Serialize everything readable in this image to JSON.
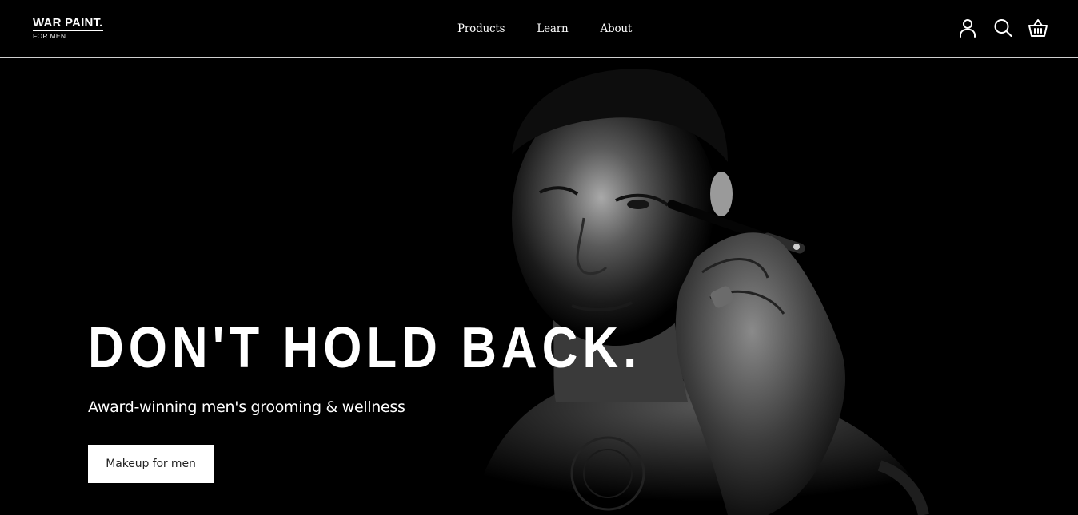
{
  "brand": {
    "name": "WAR PAINT.",
    "tagline": "FOR MEN"
  },
  "nav": {
    "items": [
      "Products",
      "Learn",
      "About"
    ]
  },
  "header_icons": [
    "account-icon",
    "search-icon",
    "basket-icon"
  ],
  "hero": {
    "headline": "DON'T HOLD BACK.",
    "subheadline": "Award-winning men's grooming & wellness",
    "cta_label": "Makeup for men"
  },
  "colors": {
    "background": "#000000",
    "text": "#ffffff",
    "button_bg": "#ffffff",
    "button_text": "#222222"
  }
}
